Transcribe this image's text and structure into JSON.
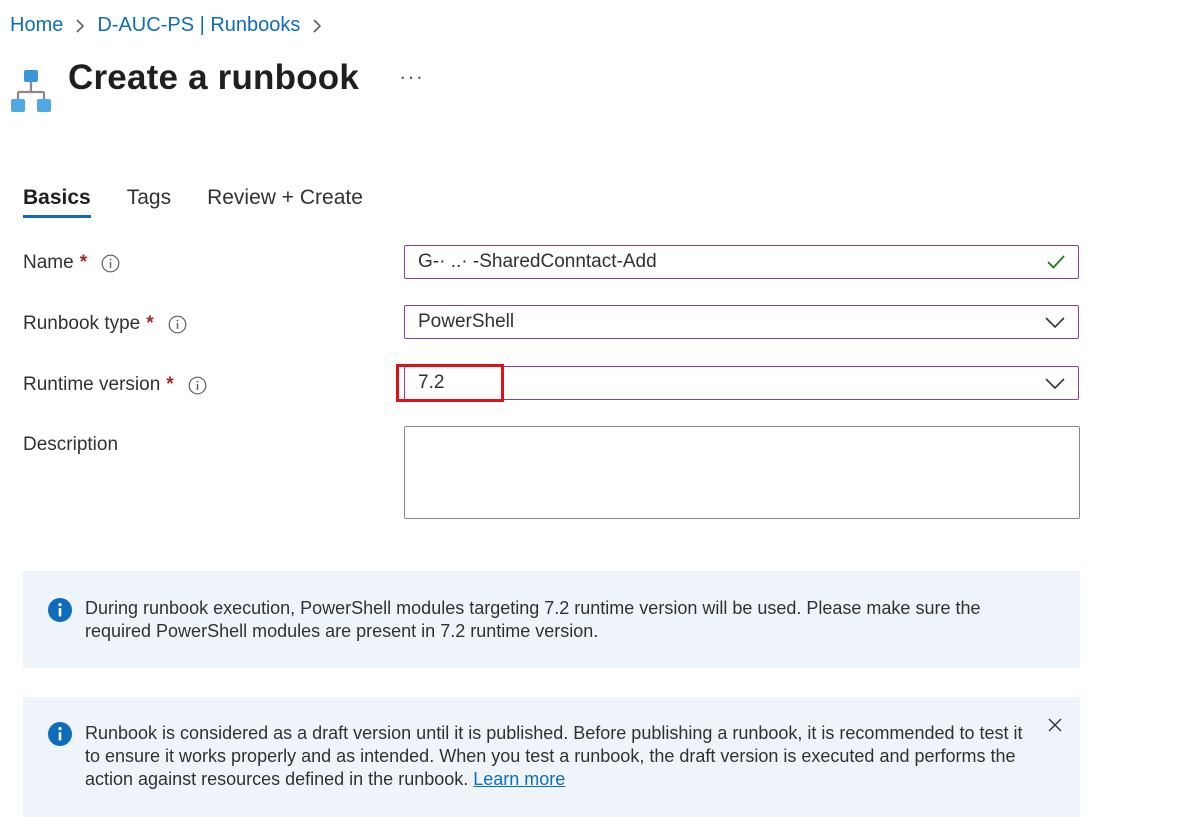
{
  "breadcrumb": {
    "items": [
      {
        "label": "Home"
      },
      {
        "label": "D-AUC-PS | Runbooks"
      }
    ]
  },
  "header": {
    "title": "Create a runbook",
    "more_label": "···",
    "icon": "runbook-hierarchy-icon"
  },
  "tabs": [
    {
      "label": "Basics",
      "active": true
    },
    {
      "label": "Tags",
      "active": false
    },
    {
      "label": "Review + Create",
      "active": false
    }
  ],
  "form": {
    "name": {
      "label": "Name",
      "required_mark": "*",
      "value": "G-· ..· -SharedConntact-Add",
      "valid": true
    },
    "runbook_type": {
      "label": "Runbook type",
      "required_mark": "*",
      "value": "PowerShell"
    },
    "runtime_version": {
      "label": "Runtime version",
      "required_mark": "*",
      "value": "7.2"
    },
    "description": {
      "label": "Description",
      "value": ""
    }
  },
  "banners": {
    "runtime_info": {
      "text": "During runbook execution, PowerShell modules targeting 7.2 runtime version will be used. Please make sure the required PowerShell modules are present in 7.2 runtime version."
    },
    "draft_info": {
      "text": "Runbook is considered as a draft version until it is published. Before publishing a runbook, it is recommended to test it to ensure it works properly and as intended. When you test a runbook, the draft version is executed and performs the action against resources defined in the runbook.",
      "link_label": "Learn more"
    }
  },
  "colors": {
    "accent": "#0f6cbd",
    "required": "#a4262c",
    "input_focus_border": "#8a3fa0",
    "valid_check": "#107c10",
    "highlight": "#e0101a",
    "banner_bg": "#eff4fb"
  }
}
